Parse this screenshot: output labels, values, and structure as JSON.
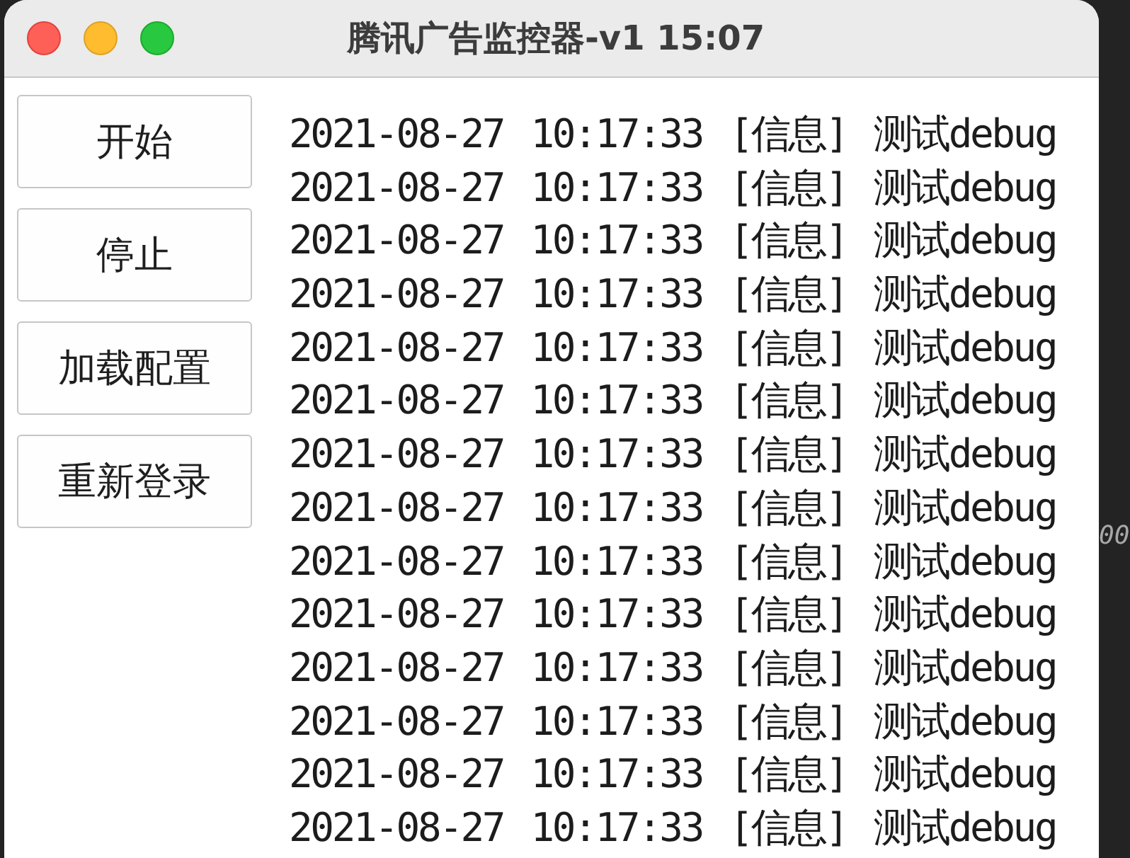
{
  "window": {
    "title": "腾讯广告监控器-v1 15:07"
  },
  "buttons": [
    "开始",
    "停止",
    "加载配置",
    "重新登录"
  ],
  "log_lines": [
    "2021-08-27 10:17:33 [信息] 测试debug",
    "2021-08-27 10:17:33 [信息] 测试debug",
    "2021-08-27 10:17:33 [信息] 测试debug",
    "2021-08-27 10:17:33 [信息] 测试debug",
    "2021-08-27 10:17:33 [信息] 测试debug",
    "2021-08-27 10:17:33 [信息] 测试debug",
    "2021-08-27 10:17:33 [信息] 测试debug",
    "2021-08-27 10:17:33 [信息] 测试debug",
    "2021-08-27 10:17:33 [信息] 测试debug",
    "2021-08-27 10:17:33 [信息] 测试debug",
    "2021-08-27 10:17:33 [信息] 测试debug",
    "2021-08-27 10:17:33 [信息] 测试debug",
    "2021-08-27 10:17:33 [信息] 测试debug",
    "2021-08-27 10:17:33 [信息] 测试debug"
  ],
  "background": {
    "text": "00"
  }
}
